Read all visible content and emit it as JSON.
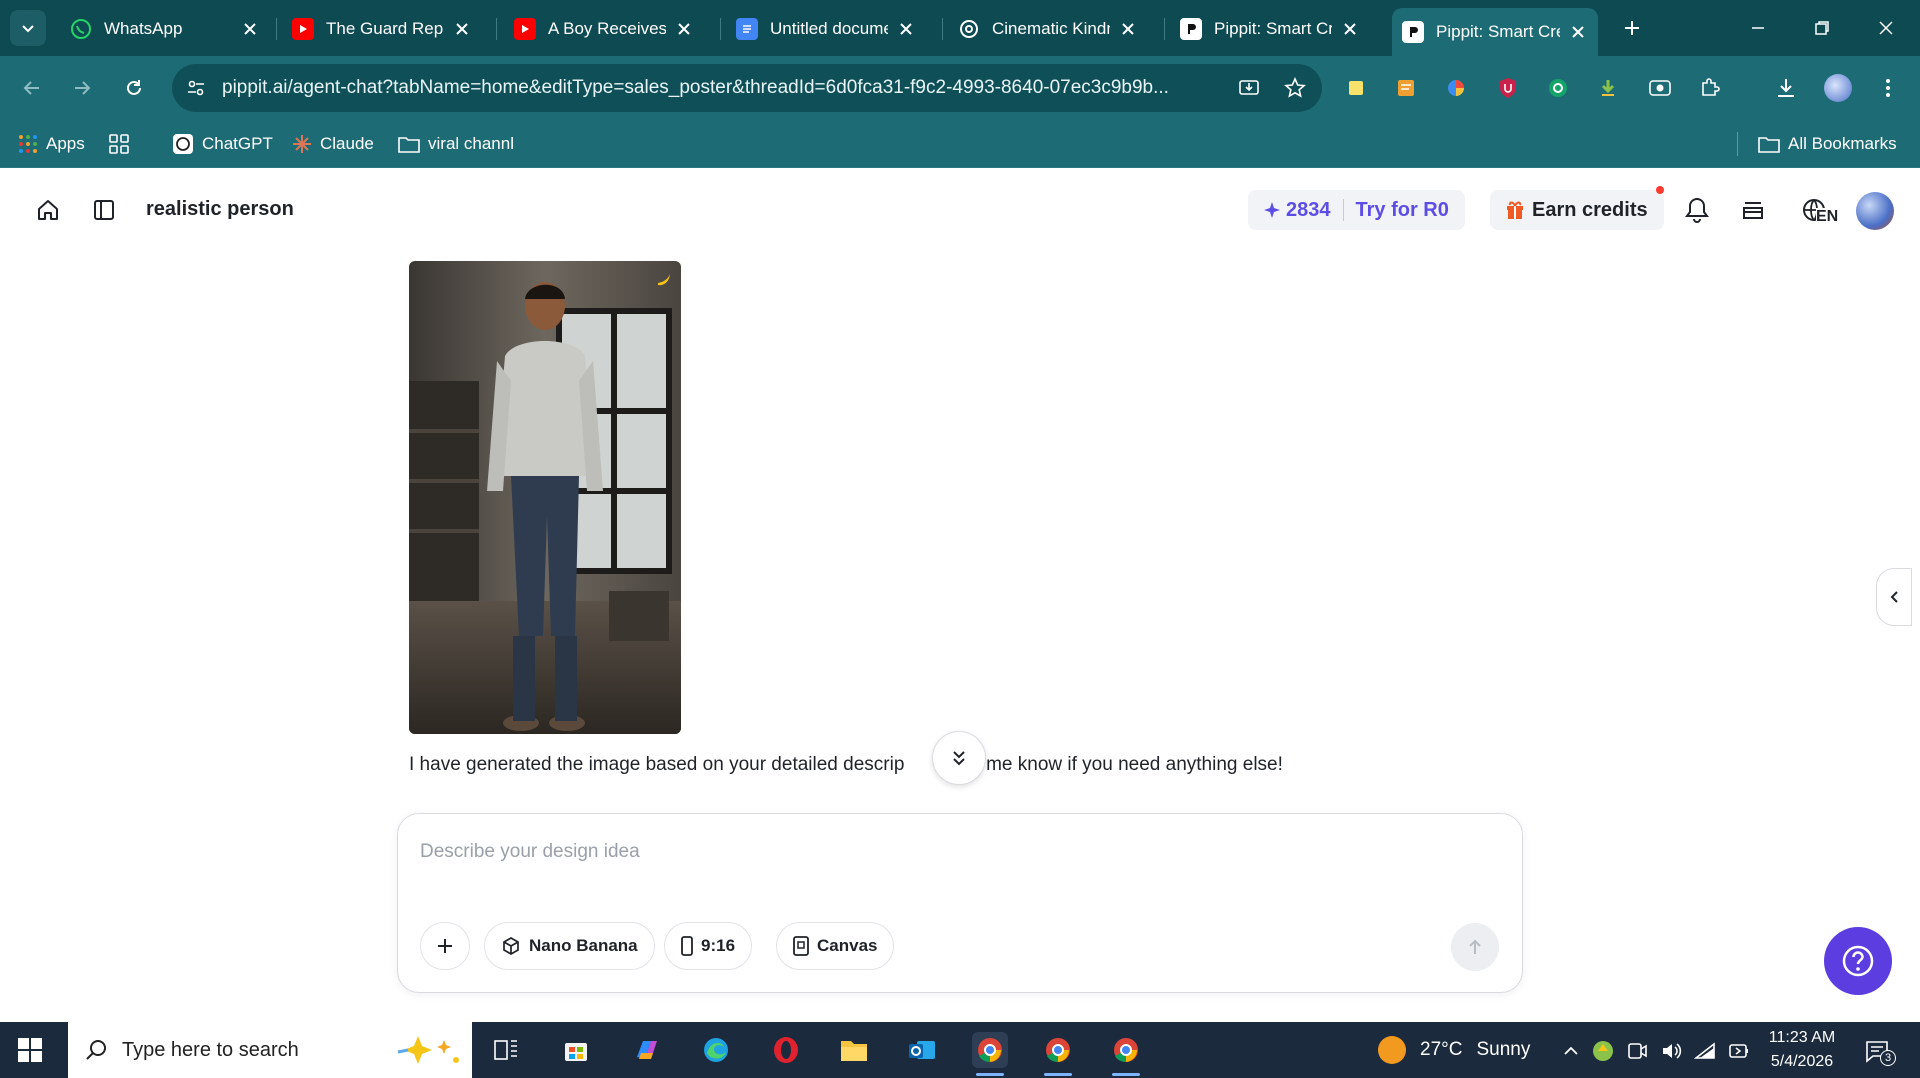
{
  "browser": {
    "tabs": [
      {
        "title": "WhatsApp",
        "icon": "whatsapp-icon",
        "color": "#25d366"
      },
      {
        "title": "The Guard Repla",
        "icon": "youtube-icon",
        "color": "#ff0000"
      },
      {
        "title": "A Boy Receives /",
        "icon": "youtube-icon",
        "color": "#ff0000"
      },
      {
        "title": "Untitled docume",
        "icon": "google-docs-icon",
        "color": "#4285f4"
      },
      {
        "title": "Cinematic Kindn",
        "icon": "chatgpt-icon",
        "color": "#ffffff"
      },
      {
        "title": "Pippit: Smart Cre",
        "icon": "pippit-icon",
        "color": "#ffffff"
      },
      {
        "title": "Pippit: Smart Cre",
        "icon": "pippit-icon",
        "color": "#ffffff",
        "active": true
      }
    ],
    "url": "pippit.ai/agent-chat?tabName=home&editType=sales_poster&threadId=6d0fca31-f9c2-4993-8640-07ec3c9b9b...",
    "bookmarks": {
      "apps": "Apps",
      "chatgpt": "ChatGPT",
      "claude": "Claude",
      "viral": "viral channl",
      "all": "All Bookmarks"
    }
  },
  "header": {
    "project_title": "realistic person",
    "credits_count": "2834",
    "try_label": "Try for R0",
    "earn_label": "Earn credits",
    "language": "EN"
  },
  "chat": {
    "message_part1": "I have generated the image based on your detailed descrip",
    "message_part2": "Let me know if you need anything else!"
  },
  "composer": {
    "placeholder": "Describe your design idea",
    "model_label": "Nano Banana",
    "ratio_label": "9:16",
    "canvas_label": "Canvas"
  },
  "taskbar": {
    "search_placeholder": "Type here to search",
    "weather_temp": "27°C",
    "weather_text": "Sunny",
    "time": "11:23 AM",
    "date": "5/4/2026",
    "notification_count": "3"
  },
  "colors": {
    "chrome_dark": "#0d4a52",
    "chrome": "#1d6b74",
    "accent": "#5b4de6",
    "help": "#5b3de0"
  }
}
